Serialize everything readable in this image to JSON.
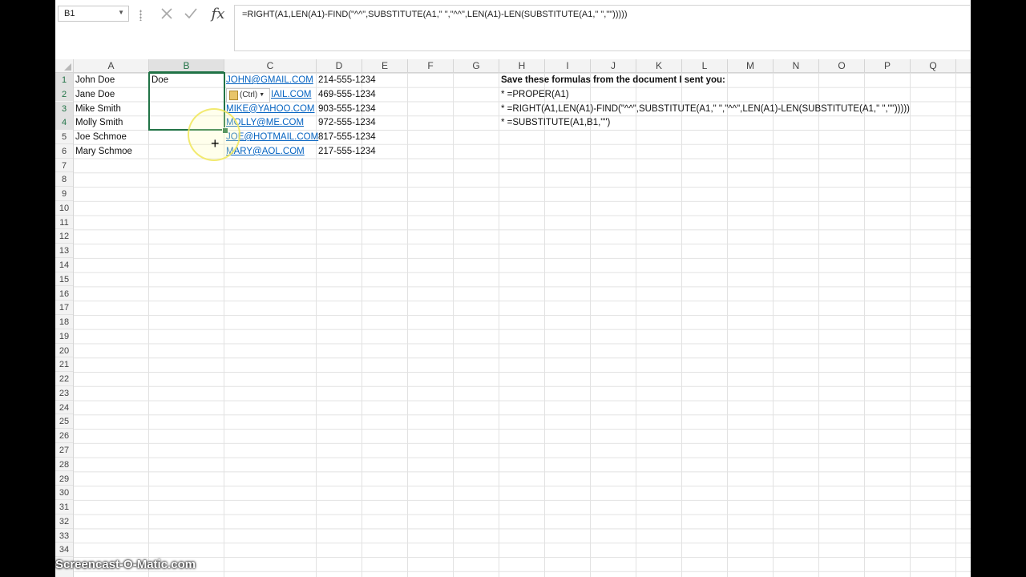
{
  "formula_bar": {
    "name_box": "B1",
    "cancel_icon": "x-icon",
    "enter_icon": "check-icon",
    "function_icon": "fx-icon",
    "function_label": "fx",
    "formula": "=RIGHT(A1,LEN(A1)-FIND(\"^^\",SUBSTITUTE(A1,\" \",\"^^\",LEN(A1)-LEN(SUBSTITUTE(A1,\" \",\"\")))))"
  },
  "columns": [
    "A",
    "B",
    "C",
    "D",
    "E",
    "F",
    "G",
    "H",
    "I",
    "J",
    "K",
    "L",
    "M",
    "N",
    "O",
    "P",
    "Q"
  ],
  "rows": [
    "1",
    "2",
    "3",
    "4",
    "5",
    "6",
    "7",
    "8",
    "9",
    "10",
    "11",
    "12",
    "13",
    "14",
    "15",
    "16",
    "17",
    "18",
    "19",
    "20",
    "21",
    "22",
    "23",
    "24",
    "25",
    "26",
    "27",
    "28",
    "29",
    "30",
    "31",
    "32",
    "33",
    "34"
  ],
  "selected_column": "B",
  "selected_rows": [
    "1",
    "2",
    "3",
    "4"
  ],
  "data": {
    "names": [
      "John Doe",
      "Jane Doe",
      "Mike Smith",
      "Molly Smith",
      "Joe Schmoe",
      "Mary Schmoe"
    ],
    "b1": "Doe",
    "emails": [
      "JOHN@GMAIL.COM",
      "IAIL.COM",
      "MIKE@YAHOO.COM",
      "MOLLY@ME.COM",
      "JOE@HOTMAIL.COM",
      "MARY@AOL.COM"
    ],
    "phones": [
      "214-555-1234",
      "469-555-1234",
      "903-555-1234",
      "972-555-1234",
      "817-555-1234",
      "217-555-1234"
    ]
  },
  "notes": {
    "heading": "Save these formulas from the document I sent you:",
    "lines": [
      "*  =PROPER(A1)",
      "*  =RIGHT(A1,LEN(A1)-FIND(\"^^\",SUBSTITUTE(A1,\" \",\"^^\",LEN(A1)-LEN(SUBSTITUTE(A1,\" \",\"\")))))",
      "*  =SUBSTITUTE(A1,B1,\"\")"
    ]
  },
  "paste_options": {
    "label": "(Ctrl)",
    "icon": "clipboard-icon"
  },
  "watermark": "Screencast-O-Matic.com",
  "colors": {
    "accent": "#217346",
    "link": "#0563c1"
  }
}
